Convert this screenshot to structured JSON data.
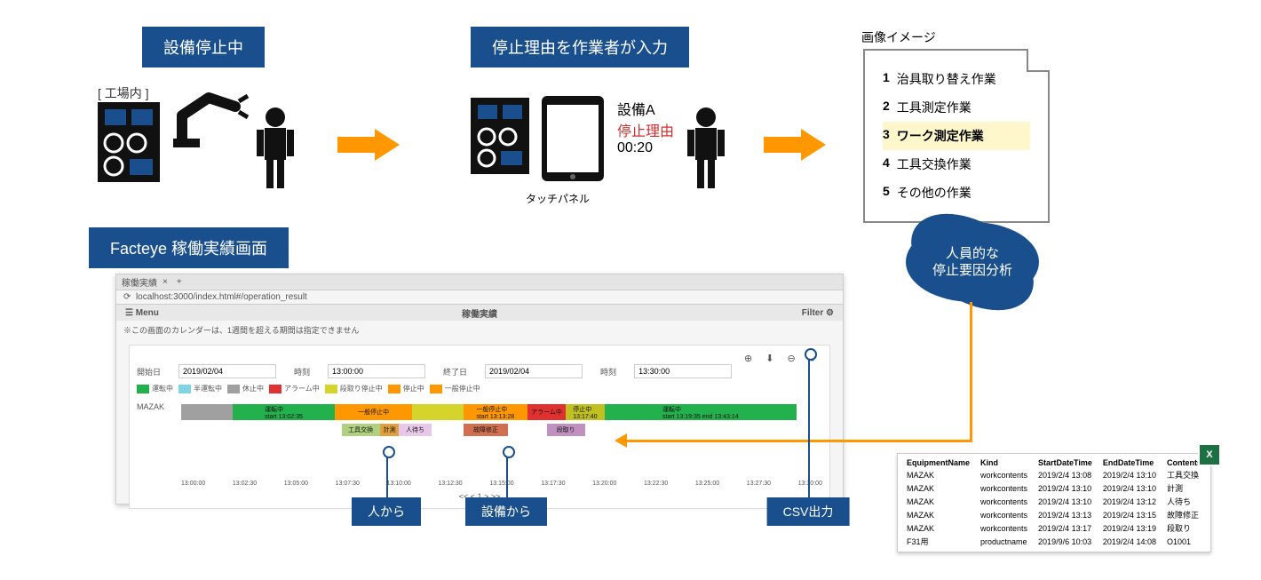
{
  "top": {
    "badge_stop": "設備停止中",
    "factory_label": "[ 工場内 ]",
    "badge_input": "停止理由を作業者が入力",
    "touchpanel": "タッチパネル",
    "device_name": "設備A",
    "stop_reason_label": "停止理由",
    "timer": "00:20",
    "image_title": "画像イメージ"
  },
  "doc": {
    "items": [
      {
        "n": "1",
        "t": "治具取り替え作業"
      },
      {
        "n": "2",
        "t": "工具測定作業"
      },
      {
        "n": "3",
        "t": "ワーク測定作業"
      },
      {
        "n": "4",
        "t": "工具交換作業"
      },
      {
        "n": "5",
        "t": "その他の作業"
      }
    ],
    "highlight_index": 2
  },
  "starburst": "人員的な\n停止要因分析",
  "facteye_badge": "Facteye 稼働実績画面",
  "browser": {
    "tab": "稼働実績",
    "url": "localhost:3000/index.html#/operation_result",
    "menu": "Menu",
    "filter": "Filter",
    "title": "稼働実績",
    "note": "※この画面のカレンダーは、1週間を超える期間は指定できません",
    "form": {
      "start_label": "開始日",
      "start_val": "2019/02/04",
      "t1_label": "時刻",
      "t1_val": "13:00:00",
      "end_label": "終了日",
      "end_val": "2019/02/04",
      "t2_label": "時刻",
      "t2_val": "13:30:00"
    },
    "legend": [
      {
        "c": "#22b14c",
        "t": "運転中"
      },
      {
        "c": "#7fd4e6",
        "t": "半運転中"
      },
      {
        "c": "#a0a0a0",
        "t": "休止中"
      },
      {
        "c": "#e03030",
        "t": "アラーム中"
      },
      {
        "c": "#d4d42c",
        "t": "段取り停止中"
      },
      {
        "c": "#ff9800",
        "t": "停止中"
      },
      {
        "c": "#ff9800",
        "t": "一般停止中"
      }
    ],
    "row_label": "MAZAK",
    "timeline_ticks": [
      "13:00:00",
      "13:02:30",
      "13:05:00",
      "13:07:30",
      "13:10:00",
      "13:12:30",
      "13:15:00",
      "13:17:30",
      "13:20:00",
      "13:22:30",
      "13:25:00",
      "13:27:30",
      "13:30:00"
    ],
    "pager": "<<  <  1  >  >>"
  },
  "pins": {
    "human": "人から",
    "equip": "設備から",
    "csv": "CSV出力"
  },
  "table": {
    "headers": [
      "EquipmentName",
      "Kind",
      "StartDateTime",
      "EndDateTime",
      "Contents"
    ],
    "rows": [
      [
        "MAZAK",
        "workcontents",
        "2019/2/4 13:08",
        "2019/2/4 13:10",
        "工具交換"
      ],
      [
        "MAZAK",
        "workcontents",
        "2019/2/4 13:10",
        "2019/2/4 13:10",
        "計測"
      ],
      [
        "MAZAK",
        "workcontents",
        "2019/2/4 13:10",
        "2019/2/4 13:12",
        "人待ち"
      ],
      [
        "MAZAK",
        "workcontents",
        "2019/2/4 13:13",
        "2019/2/4 13:15",
        "故障修正"
      ],
      [
        "MAZAK",
        "workcontents",
        "2019/2/4 13:17",
        "2019/2/4 13:19",
        "段取り"
      ],
      [
        "F31用",
        "productname",
        "2019/9/6 10:03",
        "2019/2/4 14:08",
        "O1001"
      ]
    ]
  }
}
